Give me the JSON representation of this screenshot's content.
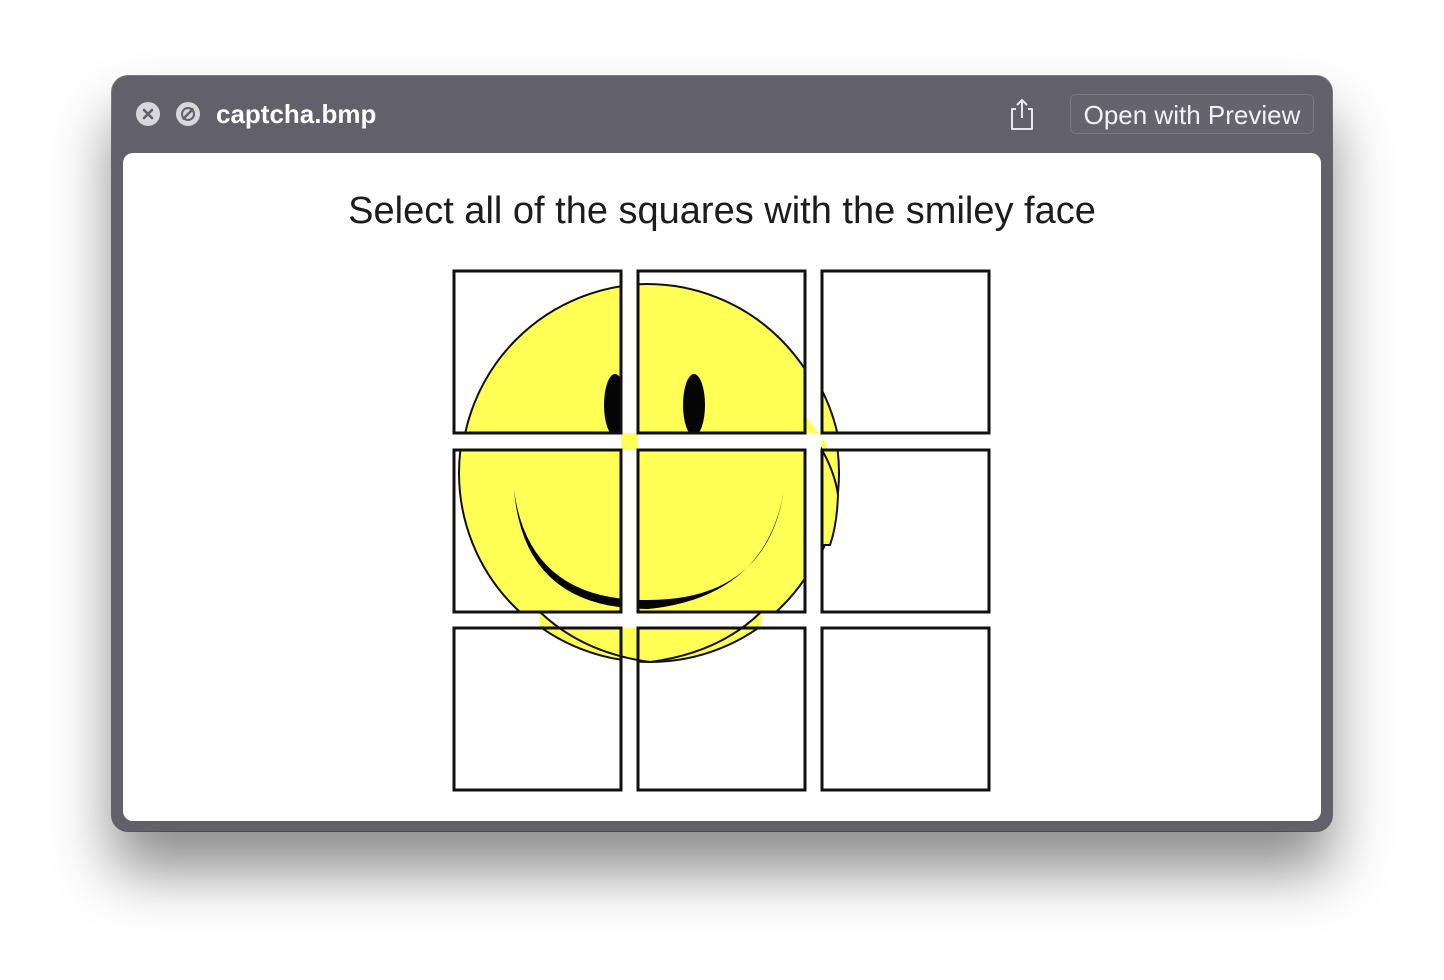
{
  "window": {
    "title": "captcha.bmp",
    "close_icon": "close-icon",
    "fullscreen_icon": "fullscreen-disabled-icon",
    "share_icon": "share-icon",
    "open_button_label": "Open with Preview"
  },
  "captcha": {
    "instruction": "Select all of the squares with the smiley face",
    "rows": 3,
    "cols": 3,
    "face_color": "#ffff55",
    "outline_color": "#111111"
  }
}
